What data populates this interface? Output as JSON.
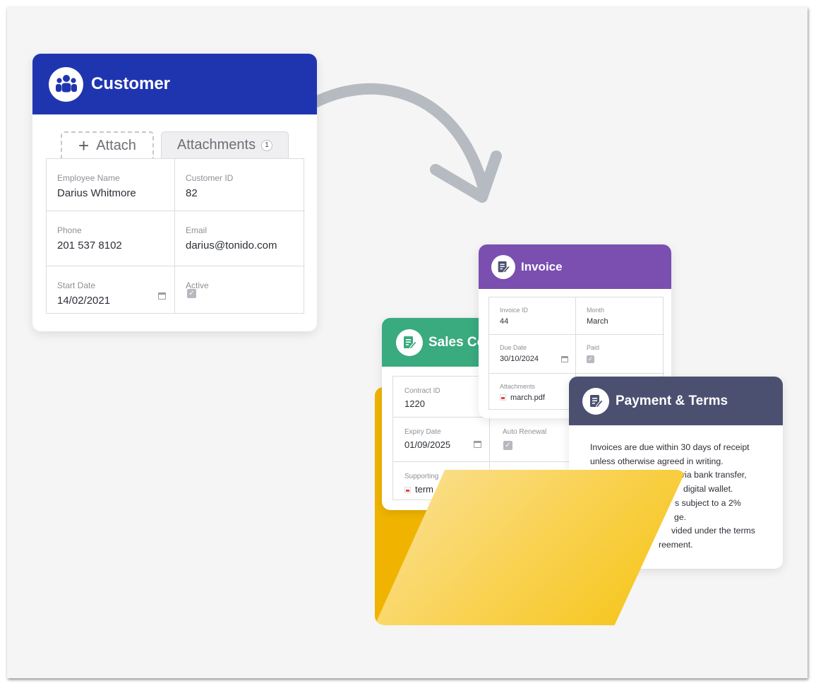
{
  "customer": {
    "title": "Customer",
    "icon": "users-icon",
    "color": "#1f35b0",
    "attach_label": "Attach",
    "attachments_label": "Attachments",
    "attachments_count": "1",
    "fields": {
      "employee_name": {
        "label": "Employee Name",
        "value": "Darius Whitmore"
      },
      "customer_id": {
        "label": "Customer ID",
        "value": "82"
      },
      "phone": {
        "label": "Phone",
        "value": "201 537 8102"
      },
      "email": {
        "label": "Email",
        "value": "darius@tonido.com"
      },
      "start_date": {
        "label": "Start Date",
        "value": "14/02/2021"
      },
      "active": {
        "label": "Active",
        "checked": true
      }
    }
  },
  "sales": {
    "title": "Sales Co",
    "icon": "document-edit-icon",
    "color": "#3aaa7f",
    "fields": {
      "contract_id": {
        "label": "Contract ID",
        "value": "1220"
      },
      "expiry_date": {
        "label": "Expiry Date",
        "value": "01/09/2025"
      },
      "auto_renewal": {
        "label": "Auto Renewal",
        "checked": true
      },
      "supporting": {
        "label": "Supporting",
        "value": "term"
      }
    }
  },
  "invoice": {
    "title": "Invoice",
    "icon": "document-edit-icon",
    "color": "#7a4fb0",
    "fields": {
      "invoice_id": {
        "label": "Invoice ID",
        "value": "44"
      },
      "month": {
        "label": "Month",
        "value": "March"
      },
      "due_date": {
        "label": "Due Date",
        "value": "30/10/2024"
      },
      "paid": {
        "label": "Paid",
        "checked": true
      },
      "attachments": {
        "label": "Attachments",
        "value": "march.pdf"
      }
    }
  },
  "payment": {
    "title": "Payment & Terms",
    "icon": "document-edit-icon",
    "color": "#4c5070",
    "lines": [
      "Invoices are due within 30 days of receipt",
      "unless otherwise agreed in writing.",
      "via bank transfer,",
      "digital wallet.",
      "s subject to a 2%",
      "ge.",
      "vided under the terms",
      "reement."
    ]
  }
}
